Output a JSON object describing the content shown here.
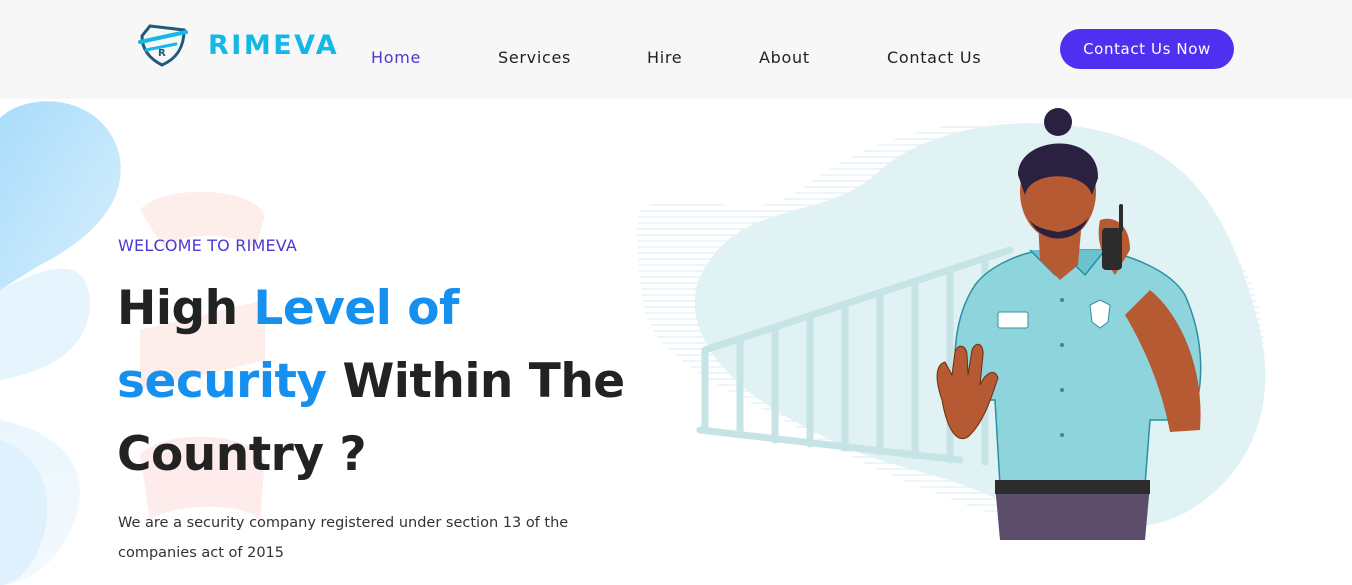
{
  "brand": {
    "name": "RIMEVA",
    "logo_icon": "shield-icon"
  },
  "nav": {
    "items": [
      {
        "label": "Home",
        "active": true
      },
      {
        "label": "Services",
        "active": false
      },
      {
        "label": "Hire",
        "active": false
      },
      {
        "label": "About",
        "active": false
      },
      {
        "label": "Contact Us",
        "active": false
      }
    ],
    "cta_label": "Contact Us Now"
  },
  "hero": {
    "eyebrow": "WELCOME TO RIMEVA",
    "headline_part1": "High ",
    "headline_highlight1": "Level of",
    "headline_highlight2": "security",
    "headline_part2": " Within The Country ?",
    "description": "We are a security company registered under section 13 of the companies act of 2015",
    "illustration": "security-guard-illustration"
  },
  "colors": {
    "accent": "#4f2ff0",
    "brand": "#14b8e6",
    "highlight": "#1590ef",
    "active_nav": "#4a3ad1",
    "uniform": "#8ed4dc"
  }
}
